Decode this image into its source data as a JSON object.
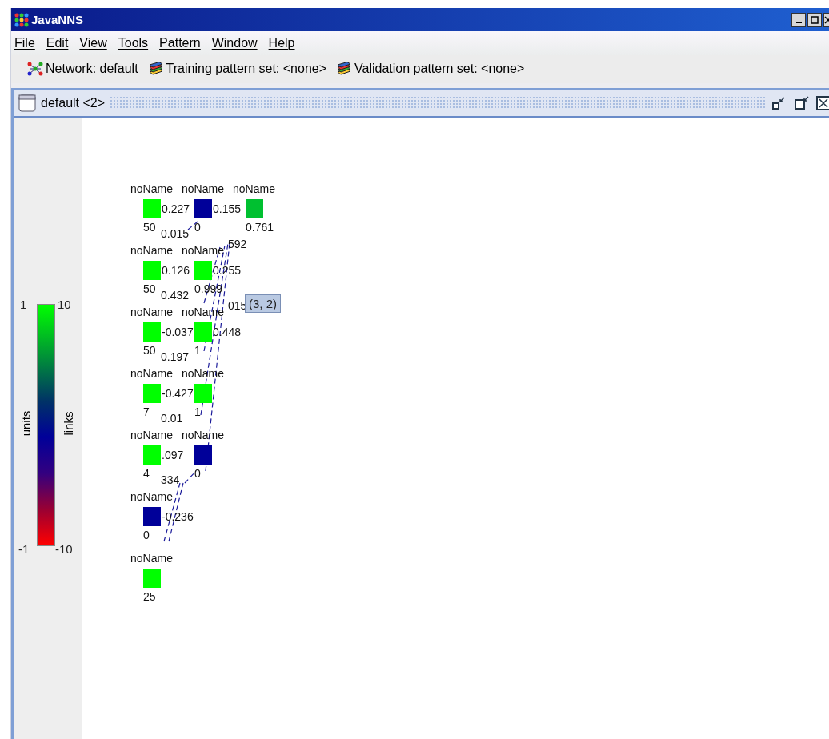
{
  "window": {
    "title": "JavaNNS"
  },
  "menu": [
    "File",
    "Edit",
    "View",
    "Tools",
    "Pattern",
    "Window",
    "Help"
  ],
  "toolbar": [
    {
      "kind": "network",
      "label": "Network: default"
    },
    {
      "kind": "pattern",
      "label": "Training pattern set: <none>"
    },
    {
      "kind": "pattern",
      "label": "Validation pattern set: <none>"
    }
  ],
  "frame": {
    "title": "default <2>"
  },
  "legend": {
    "units_label": "units",
    "links_label": "links",
    "units_max": "1",
    "units_min": "-1",
    "links_max": "10",
    "links_min": "-10"
  },
  "columns": [
    {
      "units": [
        {
          "name": "noName",
          "activation": "50",
          "color": "#00ff00",
          "labels": [
            {
              "kind": "right",
              "text": "0.227"
            },
            {
              "kind": "below",
              "text": "0.015"
            }
          ]
        },
        {
          "name": "noName",
          "activation": "50",
          "color": "#00ff00",
          "labels": [
            {
              "kind": "right",
              "text": "0.126"
            },
            {
              "kind": "below",
              "text": "0.432"
            }
          ]
        },
        {
          "name": "noName",
          "activation": "50",
          "color": "#00ff00",
          "labels": [
            {
              "kind": "right",
              "text": "-0.037"
            },
            {
              "kind": "below",
              "text": "0.197"
            }
          ]
        },
        {
          "name": "noName",
          "activation": "7",
          "color": "#00ff00",
          "labels": [
            {
              "kind": "right",
              "text": "-0.427"
            },
            {
              "kind": "below",
              "text": "0.01"
            }
          ]
        },
        {
          "name": "noName",
          "activation": "4",
          "color": "#00ff00",
          "labels": [
            {
              "kind": "right",
              "text": ".097"
            },
            {
              "kind": "below",
              "text": "334"
            }
          ]
        },
        {
          "name": "noName",
          "activation": "0",
          "color": "#000099",
          "labels": [
            {
              "kind": "right",
              "text": "-0.236"
            }
          ]
        },
        {
          "name": "noName",
          "activation": "25",
          "color": "#00ff00"
        }
      ]
    },
    {
      "units": [
        {
          "name": "noName",
          "activation": "0",
          "color": "#000099",
          "labels": [
            {
              "kind": "right",
              "text": "0.155"
            },
            {
              "kind": "side",
              "text": "592"
            }
          ]
        },
        {
          "name": "noName",
          "activation": "0.999",
          "color": "#00ff00",
          "labels": [
            {
              "kind": "right",
              "text": "0.255"
            },
            {
              "kind": "side",
              "text": "015"
            }
          ]
        },
        {
          "name": "noName",
          "activation": "1",
          "color": "#00ff00",
          "labels": [
            {
              "kind": "right",
              "text": "0.448"
            }
          ]
        },
        {
          "name": "noName",
          "activation": "1",
          "color": "#00ff00"
        },
        {
          "name": "noName",
          "activation": "0",
          "color": "#000099"
        }
      ]
    },
    {
      "units": [
        {
          "name": "noName",
          "activation": "0.761",
          "color": "#00c030"
        }
      ]
    }
  ],
  "tooltip": "(3, 2)"
}
